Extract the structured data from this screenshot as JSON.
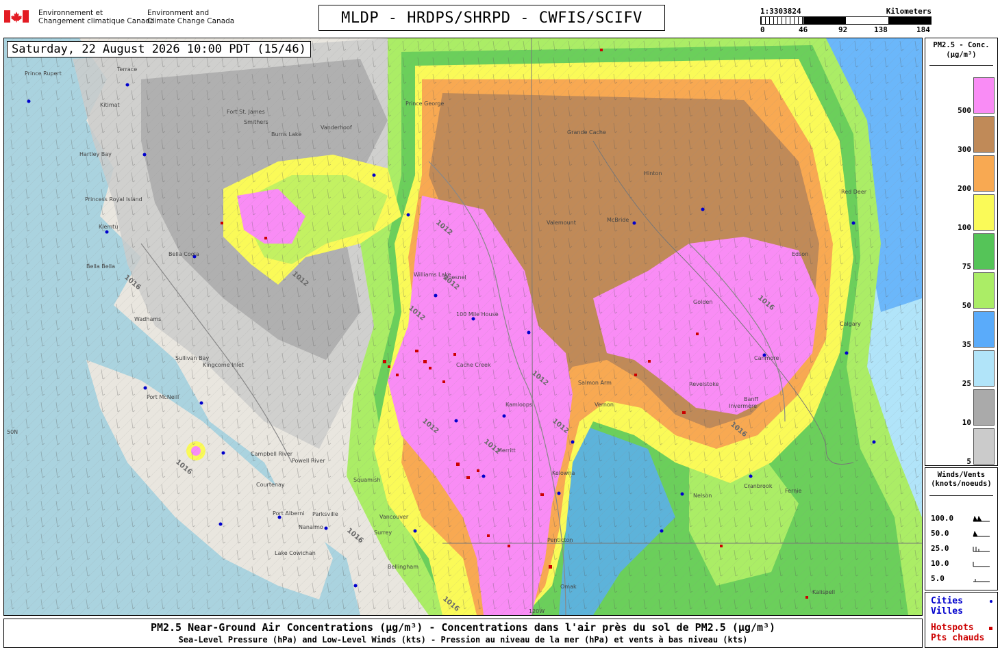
{
  "header": {
    "gov_fr_line1": "Environnement et",
    "gov_fr_line2": "Changement climatique Canada",
    "gov_en_line1": "Environment and",
    "gov_en_line2": "Climate Change Canada",
    "title": "MLDP - HRDPS/SHRPD - CWFIS/SCIFV"
  },
  "scale": {
    "ratio": "1:3303824",
    "unit": "Kilometers",
    "ticks": [
      "0",
      "46",
      "92",
      "138",
      "184"
    ]
  },
  "map": {
    "date_label": "Saturday, 22 August 2026 10:00 PDT (15/46)",
    "place_labels": [
      "Prince Rupert",
      "Terrace",
      "Kitimat",
      "Hartley Bay",
      "Princess Royal Island",
      "Klemtu",
      "Bella Coola",
      "Bella Bella",
      "Wadhams",
      "Sullivan Bay",
      "Port McNeill",
      "Kingcome Inlet",
      "Campbell River",
      "Courtenay",
      "Port Alberni",
      "Parksville",
      "Nanaimo",
      "Lake Cowichan",
      "Powell River",
      "Squamish",
      "Vancouver",
      "Surrey",
      "Bellingham",
      "Williams Lake",
      "100 Mile House",
      "Cache Creek",
      "Kamloops",
      "Merritt",
      "Kelowna",
      "Penticton",
      "Omak",
      "Vernon",
      "Salmon Arm",
      "Revelstoke",
      "Golden",
      "Nelson",
      "Cranbrook",
      "Fernie",
      "Valemount",
      "Hinton",
      "Edson",
      "Grande Cache",
      "Canmore",
      "Calgary",
      "Red Deer",
      "Banff",
      "Invermere",
      "Kalispell",
      "Fort St. James",
      "Burns Lake",
      "Smithers",
      "Prince George",
      "Quesnel",
      "Vanderhoof",
      "McBride"
    ],
    "isobar_labels": [
      "1012",
      "1012",
      "1012",
      "1016",
      "1012",
      "1016",
      "1016",
      "1012",
      "1012",
      "1016",
      "1016",
      "1012",
      "1012",
      "1016"
    ],
    "lat_label": "50N",
    "lon_label": "120W"
  },
  "legend": {
    "title_line1": "PM2.5 - Conc.",
    "title_line2": "(μg/m³)",
    "entries": [
      {
        "label": "500",
        "color": "#f98cf5"
      },
      {
        "label": "300",
        "color": "#c08a58"
      },
      {
        "label": "200",
        "color": "#f8a952"
      },
      {
        "label": "100",
        "color": "#fafa58"
      },
      {
        "label": "75",
        "color": "#55c458"
      },
      {
        "label": "50",
        "color": "#abed66"
      },
      {
        "label": "35",
        "color": "#5aabfa"
      },
      {
        "label": "25",
        "color": "#b1e4f9"
      },
      {
        "label": "10",
        "color": "#aaaaaa"
      },
      {
        "label": "5",
        "color": "#cbcbcb"
      }
    ]
  },
  "winds_legend": {
    "title_line1": "Winds/Vents",
    "title_line2": "(knots/noeuds)",
    "rows": [
      "100.0",
      "50.0",
      "25.0",
      "10.0",
      "5.0"
    ]
  },
  "markers_legend": {
    "cities_en": "Cities",
    "cities_fr": "Villes",
    "hotspots_en": "Hotspots",
    "hotspots_fr": "Pts chauds",
    "city_color": "#0000cc",
    "hotspot_color": "#cc0000"
  },
  "caption": {
    "line1": "PM2.5 Near-Ground Air Concentrations (μg/m³) - Concentrations dans l'air près du sol de PM2.5 (μg/m³)",
    "line2": "Sea-Level Pressure (hPa) and Low-Level Winds (kts) - Pression au niveau de la mer (hPa) et vents à bas niveau (kts)"
  }
}
